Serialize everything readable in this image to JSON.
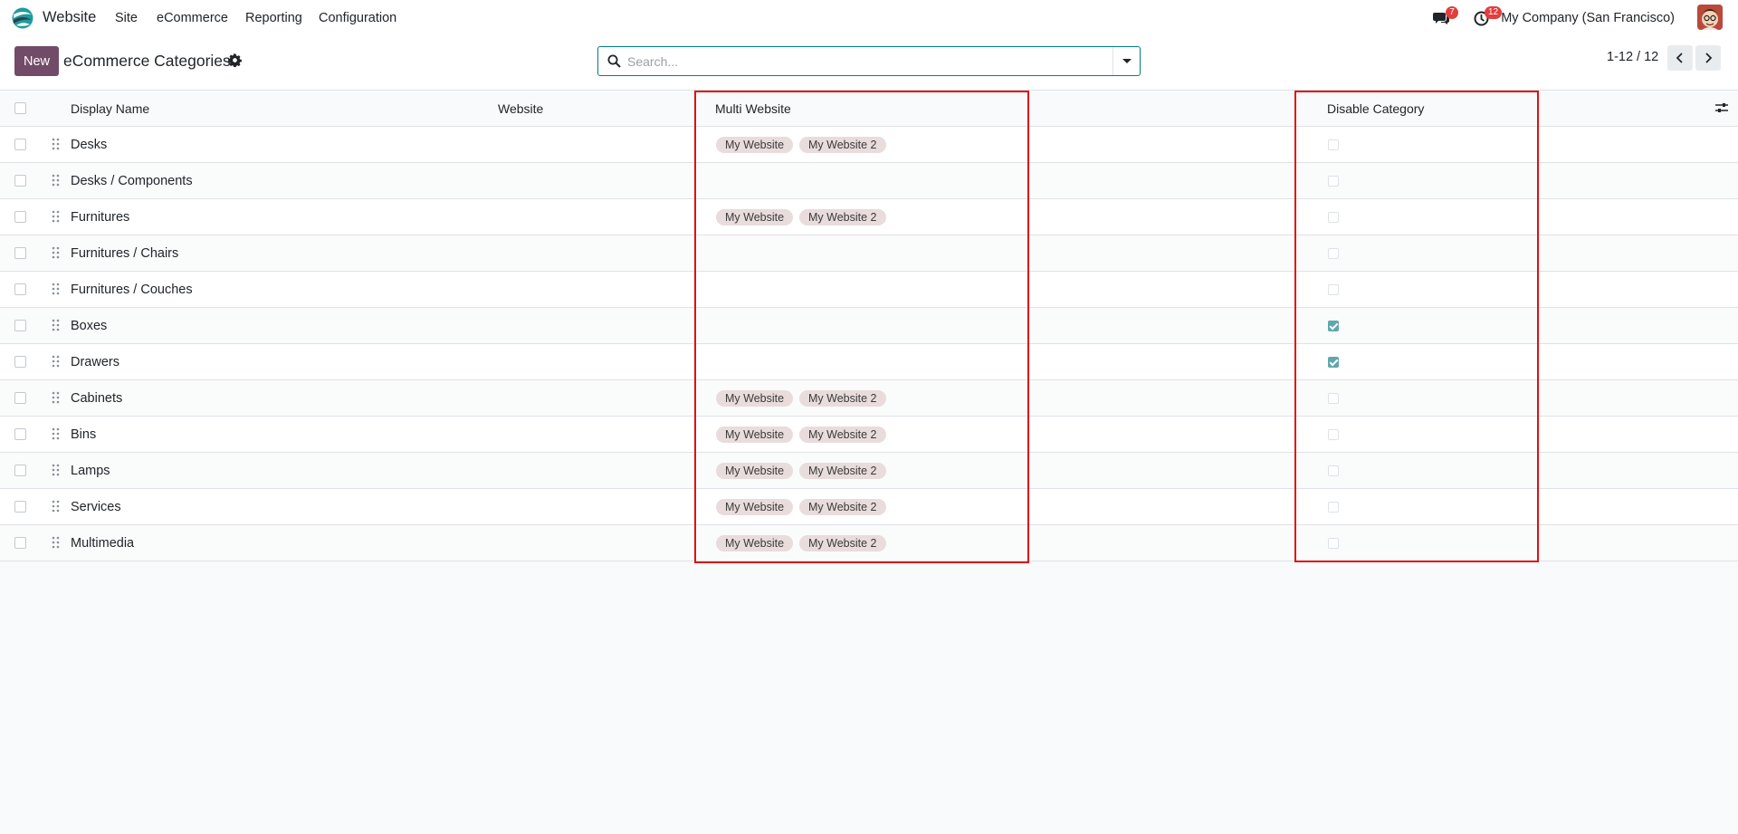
{
  "navbar": {
    "app_name": "Website",
    "menus": [
      "Site",
      "eCommerce",
      "Reporting",
      "Configuration"
    ],
    "messages_badge": "7",
    "activities_badge": "12",
    "company": "My Company (San Francisco)",
    "icons": {
      "logo": "odoo-website-logo-icon",
      "messages": "chat-bubbles-icon",
      "activities": "clock-icon",
      "avatar": "user-avatar"
    }
  },
  "control_panel": {
    "new_label": "New",
    "breadcrumb": "eCommerce Categories",
    "search_placeholder": "Search...",
    "pager": "1-12 / 12"
  },
  "list": {
    "columns": [
      "Display Name",
      "Website",
      "Multi Website",
      "Disable Category"
    ],
    "rows": [
      {
        "name": "Desks",
        "tags": [
          "My Website",
          "My Website 2"
        ],
        "disabled": false
      },
      {
        "name": "Desks / Components",
        "tags": [],
        "disabled": false
      },
      {
        "name": "Furnitures",
        "tags": [
          "My Website",
          "My Website 2"
        ],
        "disabled": false
      },
      {
        "name": "Furnitures / Chairs",
        "tags": [],
        "disabled": false
      },
      {
        "name": "Furnitures / Couches",
        "tags": [],
        "disabled": false
      },
      {
        "name": "Boxes",
        "tags": [],
        "disabled": true
      },
      {
        "name": "Drawers",
        "tags": [],
        "disabled": true
      },
      {
        "name": "Cabinets",
        "tags": [
          "My Website",
          "My Website 2"
        ],
        "disabled": false
      },
      {
        "name": "Bins",
        "tags": [
          "My Website",
          "My Website 2"
        ],
        "disabled": false
      },
      {
        "name": "Lamps",
        "tags": [
          "My Website",
          "My Website 2"
        ],
        "disabled": false
      },
      {
        "name": "Services",
        "tags": [
          "My Website",
          "My Website 2"
        ],
        "disabled": false
      },
      {
        "name": "Multimedia",
        "tags": [
          "My Website",
          "My Website 2"
        ],
        "disabled": false
      }
    ]
  },
  "colors": {
    "brand": "#714b67",
    "accent": "#017e84",
    "highlight": "#e01010",
    "checkbox_checked": "#5fa7ad",
    "tag_bg": "#e9dcdc"
  }
}
